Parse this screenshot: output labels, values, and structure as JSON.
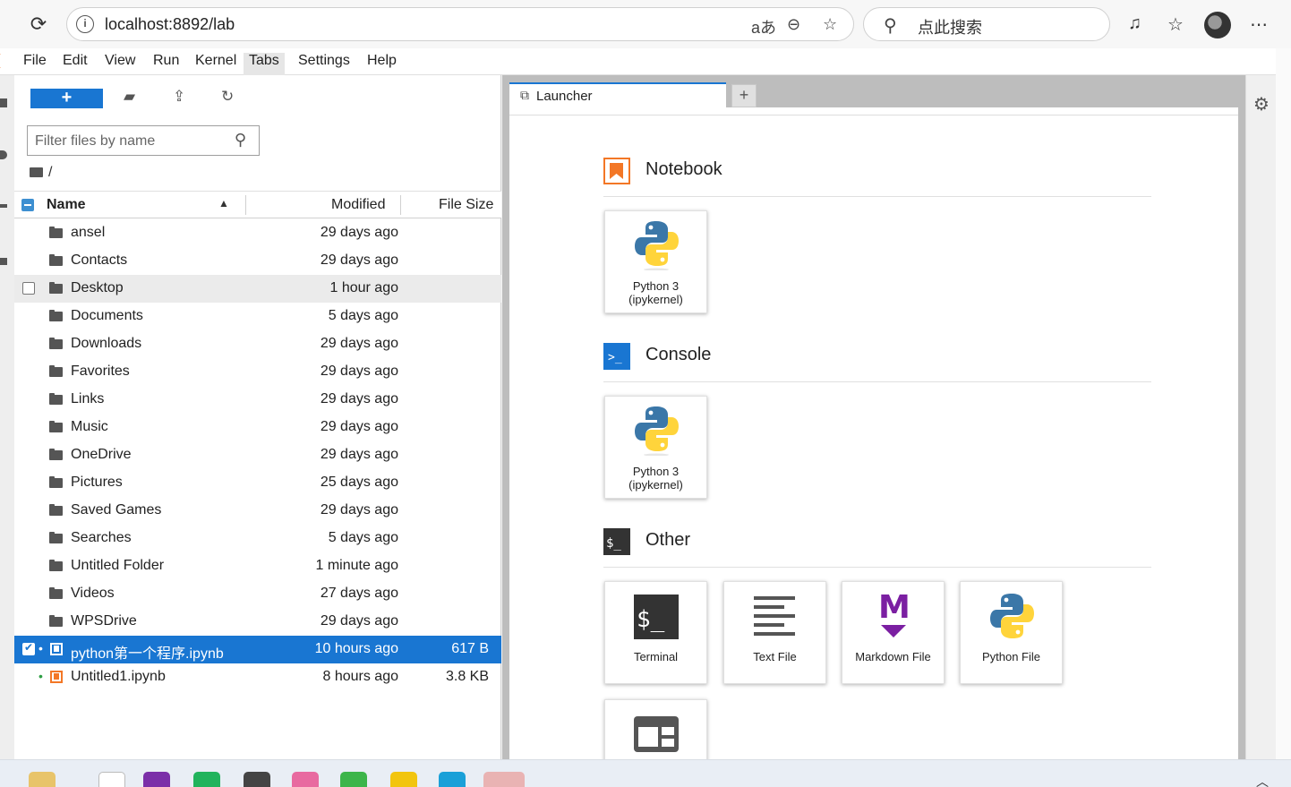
{
  "browser": {
    "url": "localhost:8892/lab",
    "search_placeholder": "点此搜索",
    "read_aloud_glyph": "aあ"
  },
  "menu": {
    "items": [
      "File",
      "Edit",
      "View",
      "Run",
      "Kernel",
      "Tabs",
      "Settings",
      "Help"
    ],
    "active": "Tabs"
  },
  "filebrowser": {
    "new_button_label": "+",
    "filter_placeholder": "Filter files by name",
    "breadcrumb": "/",
    "columns": {
      "name": "Name",
      "modified": "Modified",
      "size": "File Size"
    },
    "rows": [
      {
        "name": "ansel",
        "modified": "29 days ago",
        "size": "",
        "type": "folder"
      },
      {
        "name": "Contacts",
        "modified": "29 days ago",
        "size": "",
        "type": "folder"
      },
      {
        "name": "Desktop",
        "modified": "1 hour ago",
        "size": "",
        "type": "folder"
      },
      {
        "name": "Documents",
        "modified": "5 days ago",
        "size": "",
        "type": "folder"
      },
      {
        "name": "Downloads",
        "modified": "29 days ago",
        "size": "",
        "type": "folder"
      },
      {
        "name": "Favorites",
        "modified": "29 days ago",
        "size": "",
        "type": "folder"
      },
      {
        "name": "Links",
        "modified": "29 days ago",
        "size": "",
        "type": "folder"
      },
      {
        "name": "Music",
        "modified": "29 days ago",
        "size": "",
        "type": "folder"
      },
      {
        "name": "OneDrive",
        "modified": "29 days ago",
        "size": "",
        "type": "folder"
      },
      {
        "name": "Pictures",
        "modified": "25 days ago",
        "size": "",
        "type": "folder"
      },
      {
        "name": "Saved Games",
        "modified": "29 days ago",
        "size": "",
        "type": "folder"
      },
      {
        "name": "Searches",
        "modified": "5 days ago",
        "size": "",
        "type": "folder"
      },
      {
        "name": "Untitled Folder",
        "modified": "1 minute ago",
        "size": "",
        "type": "folder"
      },
      {
        "name": "Videos",
        "modified": "27 days ago",
        "size": "",
        "type": "folder"
      },
      {
        "name": "WPSDrive",
        "modified": "29 days ago",
        "size": "",
        "type": "folder"
      },
      {
        "name": "python第一个程序.ipynb",
        "modified": "10 hours ago",
        "size": "617 B",
        "type": "notebook"
      },
      {
        "name": "Untitled1.ipynb",
        "modified": "8 hours ago",
        "size": "3.8 KB",
        "type": "notebook"
      }
    ]
  },
  "launcher": {
    "tab_label": "Launcher",
    "sections": {
      "notebook": {
        "title": "Notebook",
        "card": "Python 3\n(ipykernel)"
      },
      "console": {
        "title": "Console",
        "card": "Python 3\n(ipykernel)"
      },
      "other": {
        "title": "Other",
        "cards": [
          "Terminal",
          "Text File",
          "Markdown File",
          "Python File"
        ]
      }
    },
    "console_icon_text": ">_",
    "other_icon_text": "$_",
    "terminal_icon_text": "$_",
    "markdown_icon_text": "M"
  },
  "colors": {
    "accent": "#1976d2",
    "notebook_orange": "#f37726",
    "python_blue": "#3b77a8",
    "python_yellow": "#ffd43b",
    "markdown_purple": "#7b1fa2"
  }
}
